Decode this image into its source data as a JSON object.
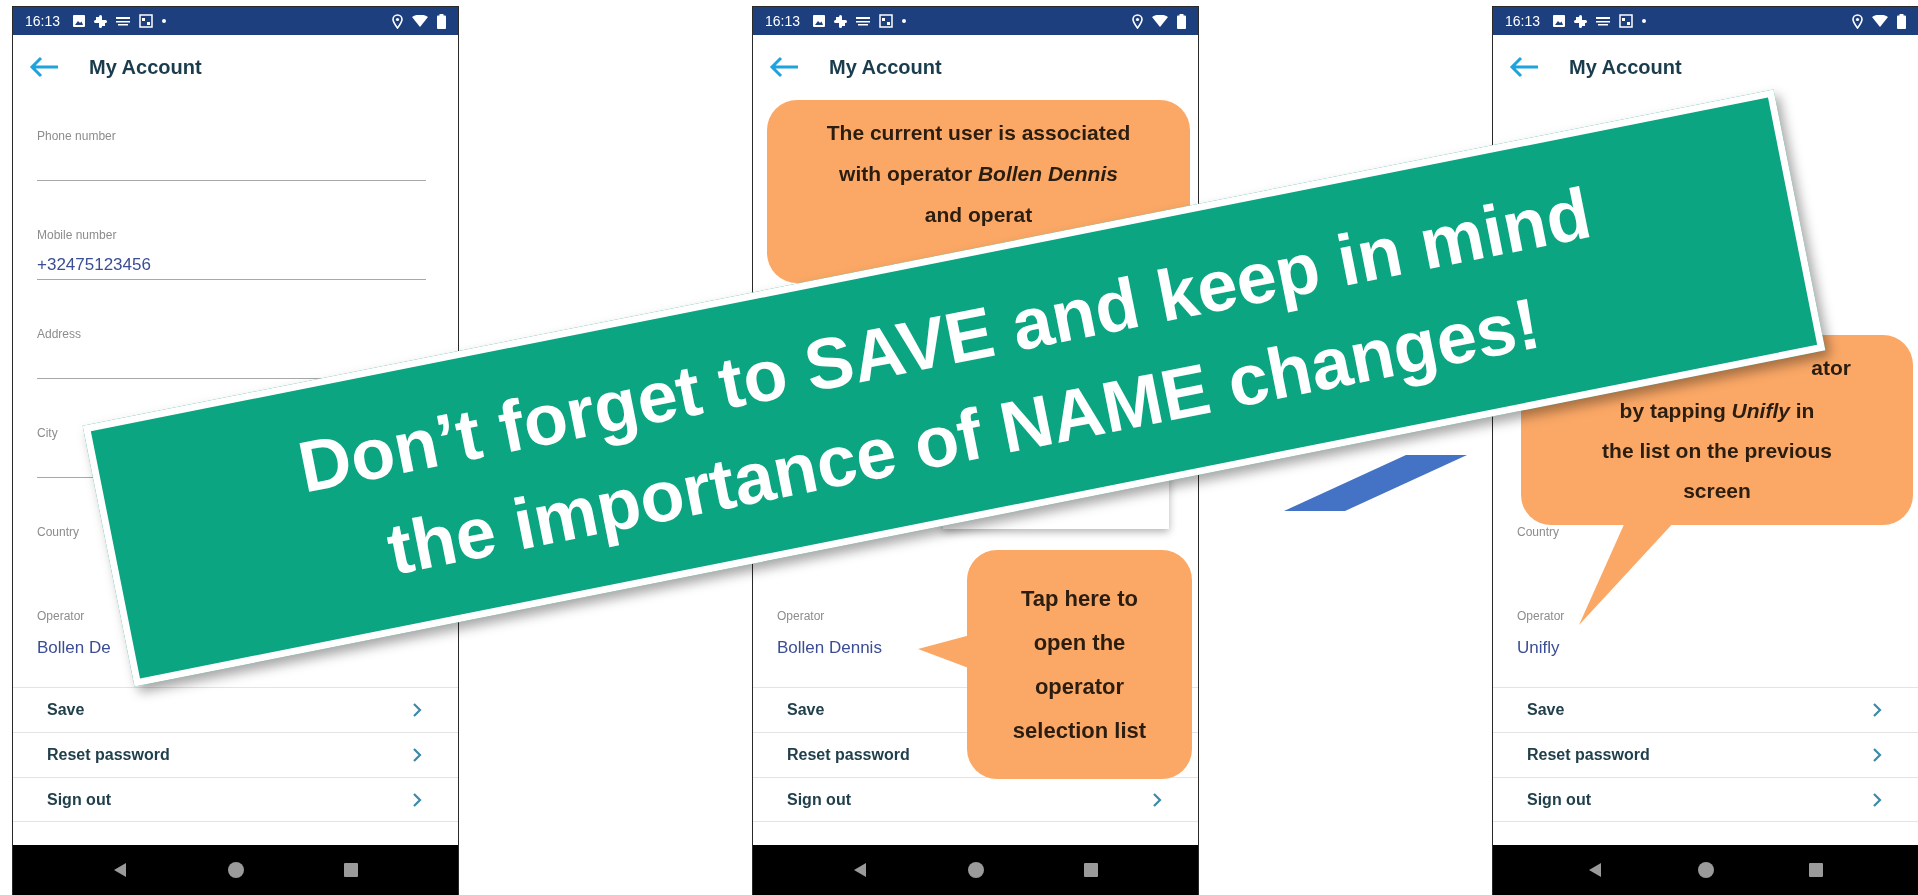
{
  "phones": [
    {
      "status_time": "16:13",
      "title": "My Account",
      "fields": [
        {
          "label": "Phone number",
          "kind": "text"
        },
        {
          "label": "Mobile number",
          "value": "+32475123456",
          "kind": "text"
        },
        {
          "label": "Address",
          "kind": "text"
        },
        {
          "label": "City",
          "kind": "text"
        },
        {
          "label": "Country",
          "kind": "picker"
        }
      ],
      "operator": {
        "label": "Operator",
        "value": "Bollen De"
      },
      "rows": [
        {
          "label": "Save",
          "chevron": true
        },
        {
          "label": "Reset password",
          "chevron": true
        },
        {
          "label": "Sign out",
          "chevron": true
        }
      ]
    },
    {
      "status_time": "16:13",
      "title": "My Account",
      "operator": {
        "label": "Operator",
        "value": "Bollen Dennis"
      },
      "rows": [
        {
          "label": "Save",
          "chevron": false
        },
        {
          "label": "Reset password",
          "chevron": false
        },
        {
          "label": "Sign out",
          "chevron": true
        }
      ],
      "callouts": [
        {
          "kind": "plain",
          "lines": [
            "The current user is associated",
            "with operator *Bollen Dennis*",
            "and operat"
          ]
        },
        {
          "kind": "pointer-left",
          "lines": [
            "Tap here to",
            "open the",
            "operator",
            "selection list"
          ]
        }
      ]
    },
    {
      "status_time": "16:13",
      "title": "My Account",
      "fields": [
        {
          "label": "Country",
          "kind": "picker"
        }
      ],
      "operator": {
        "label": "Operator",
        "value": "Unifly"
      },
      "rows": [
        {
          "label": "Save",
          "chevron": true
        },
        {
          "label": "Reset password",
          "chevron": true
        },
        {
          "label": "Sign out",
          "chevron": true
        }
      ],
      "callouts": [
        {
          "kind": "pointer-down",
          "fragment": "ator",
          "lines": [
            "by tapping *Unifly* in",
            "the list on the previous",
            "screen"
          ]
        }
      ]
    }
  ],
  "banner": {
    "lines": [
      [
        "Don’t forget to SAVE and",
        "keep in mind"
      ],
      [
        "the importance of NAME",
        "changes!"
      ]
    ]
  }
}
